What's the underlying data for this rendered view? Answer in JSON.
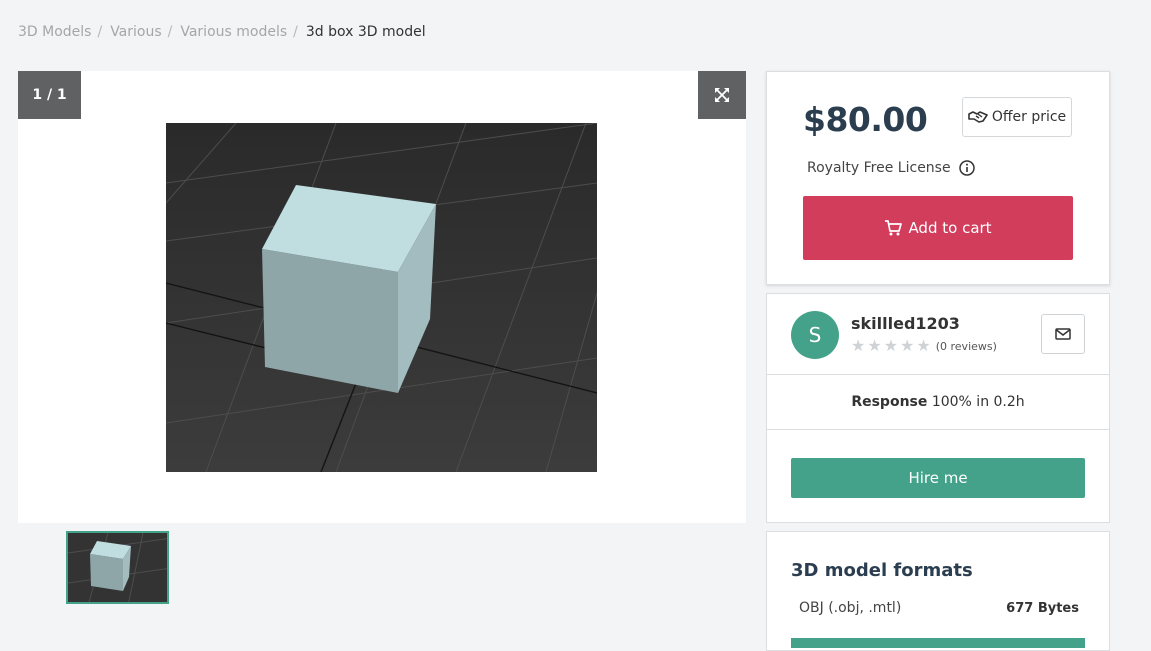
{
  "breadcrumb": {
    "items": [
      "3D Models",
      "Various",
      "Various models"
    ],
    "current": "3d box 3D model",
    "separator": "/"
  },
  "viewer": {
    "counter": "1 / 1",
    "expand_icon": "expand-arrows-icon"
  },
  "purchase": {
    "price": "$80.00",
    "offer_label": "Offer price",
    "license": "Royalty Free License",
    "add_to_cart": "Add to cart"
  },
  "seller": {
    "initial": "S",
    "name": "skillled1203",
    "rating": 0,
    "max_rating": 5,
    "reviews": "(0 reviews)",
    "response_label": "Response",
    "response_value": "100% in 0.2h",
    "hire_label": "Hire me"
  },
  "formats": {
    "title": "3D model formats",
    "items": [
      {
        "name": "OBJ (.obj, .mtl)",
        "size": "677 Bytes"
      }
    ]
  },
  "colors": {
    "accent_teal": "#44a28a",
    "cart_red": "#d23d5c",
    "price_text": "#2b3e50"
  }
}
